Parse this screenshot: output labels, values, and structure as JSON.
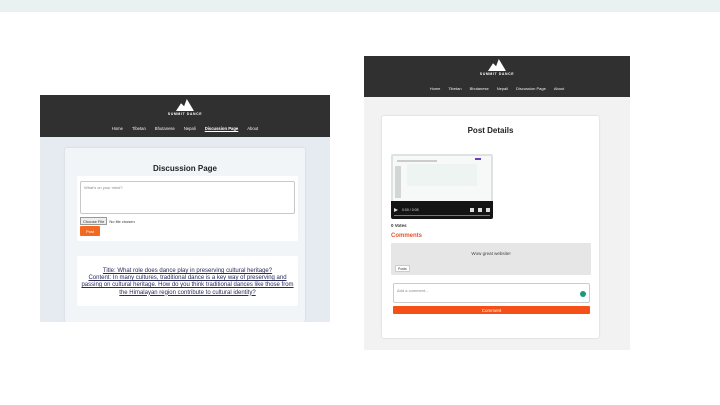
{
  "left_page": {
    "logo_text": "SUMMIT DANCE",
    "nav": [
      "Home",
      "Tibetan",
      "Bhutanese",
      "Nepali",
      "Discussion Page",
      "About"
    ],
    "active_nav": "Discussion Page",
    "page_title": "Discussion Page",
    "composer": {
      "placeholder": "What's on your mind?",
      "file_button": "Choose File",
      "file_status": "No file chosen",
      "post_button": "Post"
    },
    "post": {
      "title_line": "Title: What role does dance play in preserving cultural heritage?",
      "content_line": "Content: In many cultures, traditional dance is a key way of preserving and passing on cultural heritage. How do you think traditional dances like those from the Himalayan region contribute to cultural identity?"
    }
  },
  "right_page": {
    "logo_text": "SUMMIT DANCE",
    "nav": [
      "Home",
      "Tibetan",
      "Bhutanese",
      "Nepali",
      "Discussion Page",
      "About"
    ],
    "page_title": "Post Details",
    "video_time": "0:00 / 0:05",
    "votes": "0 Votes",
    "comments_title": "Comments",
    "comment": {
      "text": "Wow great website!",
      "tag": "Posts"
    },
    "comment_placeholder": "Add a comment...",
    "comment_button": "Comment"
  },
  "colors": {
    "header": "#303030",
    "accent": "#f26a21",
    "comments_title": "#e4572e"
  }
}
